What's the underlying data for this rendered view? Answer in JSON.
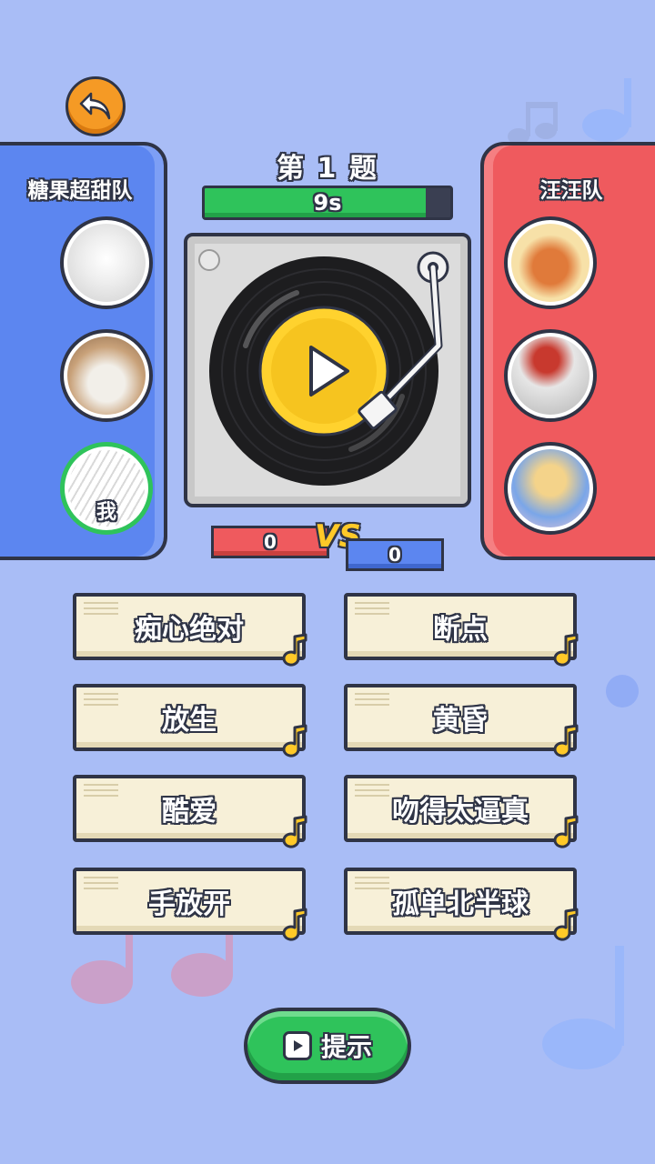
{
  "quiz": {
    "question_label": "第 1 题",
    "timer_text": "9s",
    "timer_fraction": 0.9
  },
  "teams": {
    "left": {
      "name": "糖果超甜队",
      "color": "#5c86f0",
      "members": [
        {
          "avatar": "white-hamster",
          "colors": [
            "#eeeeee",
            "#cfcfcf"
          ]
        },
        {
          "avatar": "puppy",
          "colors": [
            "#c9a27a",
            "#f2efe9"
          ]
        },
        {
          "avatar": "sketch-girl",
          "colors": [
            "#ffffff",
            "#9a9a9a"
          ],
          "tag": "我"
        }
      ]
    },
    "right": {
      "name": "汪汪队",
      "color": "#ef5a5e",
      "members": [
        {
          "avatar": "red-panda-cartoon",
          "colors": [
            "#f7e1a8",
            "#e07a3a"
          ]
        },
        {
          "avatar": "person-red-hat",
          "colors": [
            "#e6e6e6",
            "#c8392e"
          ]
        },
        {
          "avatar": "anime-girl",
          "colors": [
            "#7aa6e8",
            "#f4d38a"
          ]
        }
      ]
    }
  },
  "scores": {
    "red": "0",
    "blue": "0",
    "vs": "VS"
  },
  "options": [
    "痴心绝对",
    "断点",
    "放生",
    "黄昏",
    "酷爱",
    "吻得太逼真",
    "手放开",
    "孤单北半球"
  ],
  "hint": {
    "label": "提示",
    "icon": "video-play-icon"
  },
  "colors": {
    "background": "#a9bdf6",
    "accent_green": "#2fc35b",
    "accent_yellow": "#ffc928",
    "outline": "#2f3446"
  }
}
